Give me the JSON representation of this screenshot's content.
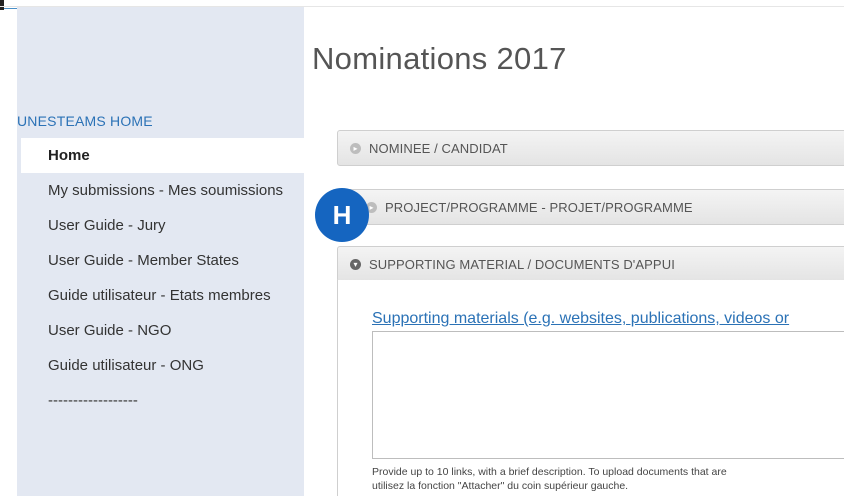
{
  "page": {
    "title": "Nominations 2017"
  },
  "sidebar": {
    "heading": "UNESTEAMS HOME",
    "items": [
      {
        "label": "Home",
        "active": true
      },
      {
        "label": "My submissions - Mes soumissions"
      },
      {
        "label": "User Guide - Jury"
      },
      {
        "label": "User Guide - Member States"
      },
      {
        "label": "Guide utilisateur - Etats membres"
      },
      {
        "label": "User Guide - NGO"
      },
      {
        "label": "Guide utilisateur - ONG"
      },
      {
        "label": "------------------"
      }
    ]
  },
  "sections": [
    {
      "label": "NOMINEE / CANDIDAT",
      "state": "collapsed"
    },
    {
      "label": "PROJECT/PROGRAMME - PROJET/PROGRAMME",
      "state": "collapsed"
    },
    {
      "label": "SUPPORTING MATERIAL / DOCUMENTS D'APPUI",
      "state": "expanded"
    }
  ],
  "supporting": {
    "title": "Supporting materials (e.g. websites, publications, videos or",
    "help_line1": "Provide up to 10 links, with a brief description. To upload documents that are",
    "help_line2": "utilisez la fonction \"Attacher\" du coin supérieur gauche."
  },
  "badge": {
    "letter": "H",
    "color": "#1565c0"
  },
  "colors": {
    "sidebar_bg": "#e3e8f2",
    "link_blue": "#2b72b6"
  }
}
